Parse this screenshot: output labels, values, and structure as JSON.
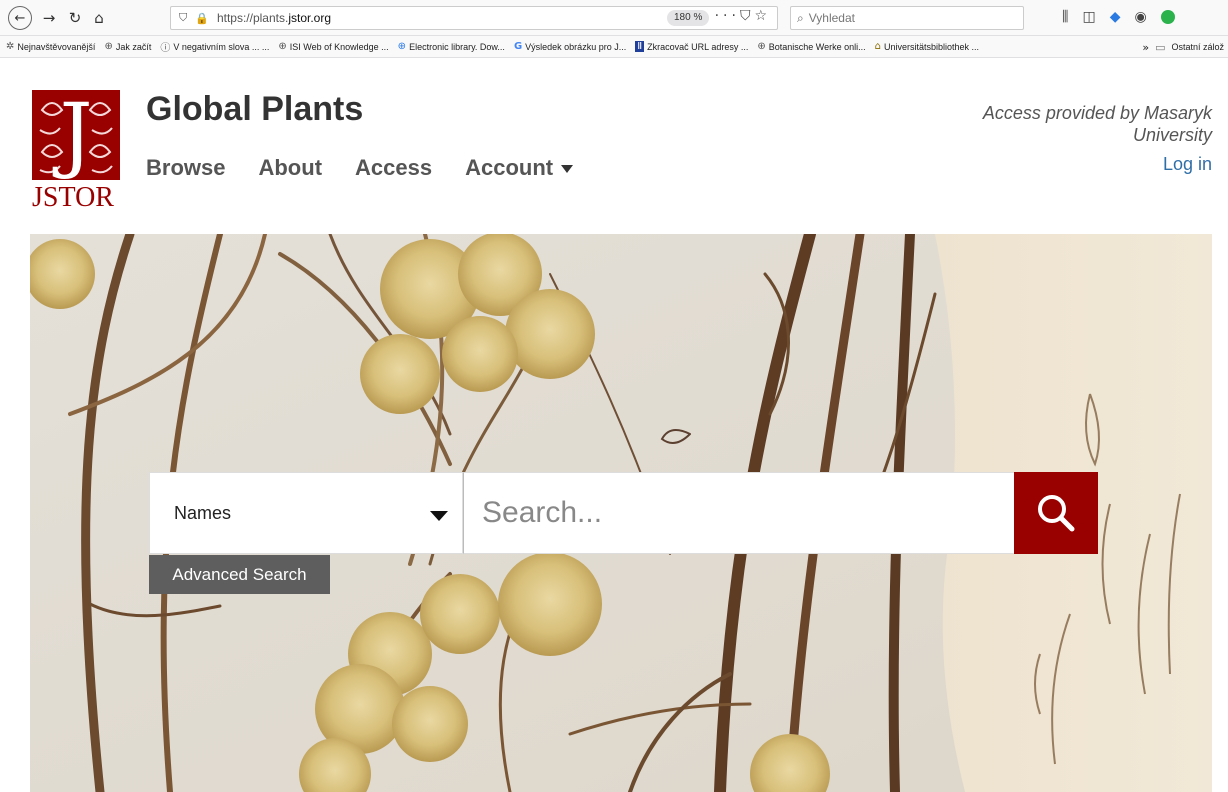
{
  "browser": {
    "url_prefix": "https://plants.",
    "url_domain": "jstor.org",
    "zoom": "180 %",
    "search_placeholder": "Vyhledat",
    "bookmarks": [
      {
        "label": "Nejnavštěvovanější",
        "icon": "gear-icon"
      },
      {
        "label": "Jak začít",
        "icon": "globe-icon"
      },
      {
        "label": "V negativním slova ... ...",
        "icon": "info-icon"
      },
      {
        "label": "ISI Web of Knowledge ...",
        "icon": "globe-icon"
      },
      {
        "label": "Electronic library. Dow...",
        "icon": "globe-icon"
      },
      {
        "label": "Výsledek obrázku pro J...",
        "icon": "google-icon"
      },
      {
        "label": "Zkracovač URL adresy ...",
        "icon": "bookmark-icon"
      },
      {
        "label": "Botanische Werke onli...",
        "icon": "globe-icon"
      },
      {
        "label": "Universitätsbibliothek ...",
        "icon": "library-icon"
      }
    ],
    "other_bookmarks": "Ostatní zálož"
  },
  "site": {
    "logo_text": "JSTOR",
    "logo_letter": "J",
    "title": "Global Plants",
    "nav": {
      "browse": "Browse",
      "about": "About",
      "access": "Access",
      "account": "Account"
    },
    "access_note": "Access provided by Masaryk University",
    "login": "Log in"
  },
  "search": {
    "scope_selected": "Names",
    "placeholder": "Search...",
    "advanced": "Advanced Search"
  },
  "colors": {
    "brand_red": "#990000",
    "link_blue": "#2f6fa8",
    "adv_button": "#5e5e5e"
  }
}
